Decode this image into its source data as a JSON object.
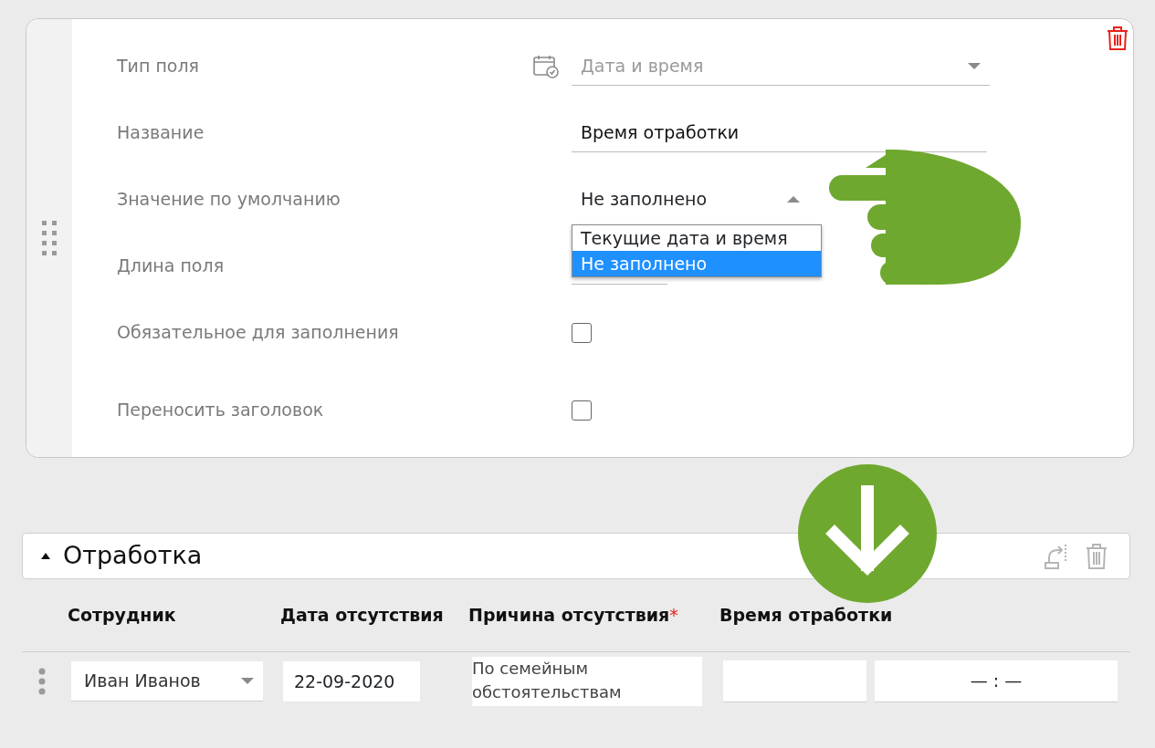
{
  "field_settings": {
    "rows": [
      {
        "kind": "select",
        "label": "Тип поля",
        "value": "Дата и время",
        "disabled": true
      },
      {
        "kind": "text",
        "label": "Название",
        "value": "Время отработки"
      },
      {
        "kind": "dropdown",
        "label": "Значение по умолчанию",
        "value": "Не заполнено",
        "expanded": true,
        "options": [
          {
            "label": "Текущие дата и время",
            "selected": false
          },
          {
            "label": "Не заполнено",
            "selected": true
          }
        ]
      },
      {
        "kind": "line",
        "label": "Длина поля"
      },
      {
        "kind": "checkbox",
        "label": "Обязательное для заполнения",
        "checked": false
      },
      {
        "kind": "checkbox",
        "label": "Переносить заголовок",
        "checked": false
      }
    ]
  },
  "section": {
    "title": "Отработка",
    "expanded": true,
    "columns": [
      {
        "label": "Сотрудник"
      },
      {
        "label": "Дата отсутствия"
      },
      {
        "label": "Причина отсутствия",
        "required_mark": "*"
      },
      {
        "label": "Время отработки"
      }
    ],
    "rows": [
      {
        "cells": [
          {
            "kind": "select",
            "value": "Иван Иванов"
          },
          {
            "kind": "date",
            "value": "22-09-2020"
          },
          {
            "kind": "textarea",
            "value": "По семейным обстоятельствам"
          },
          {
            "kind": "blank"
          },
          {
            "kind": "time",
            "value": "— : —"
          }
        ]
      }
    ]
  }
}
